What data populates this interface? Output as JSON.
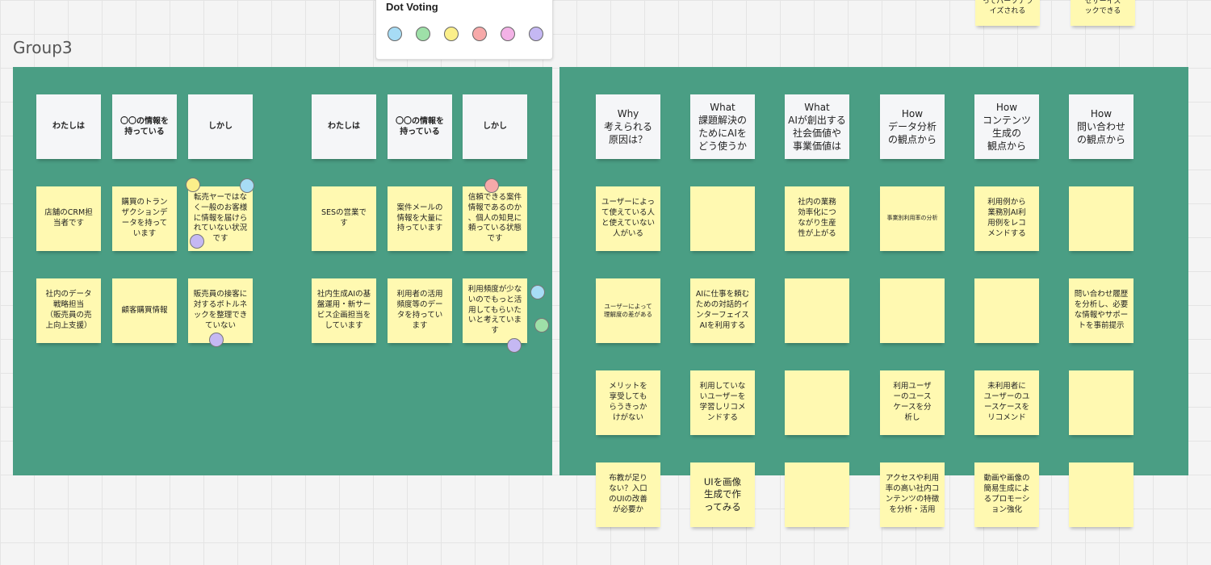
{
  "frame_title": "Group3",
  "voting": {
    "title": "Dot Voting",
    "colors": [
      "#a7dcf5",
      "#9ee0a8",
      "#fbef8a",
      "#f7a9a9",
      "#f3b2e6",
      "#c5b8f3"
    ]
  },
  "top_notes": [
    {
      "text": "ってパーソナラ\nイズされる"
    },
    {
      "text": "セサーイス\nックできる"
    }
  ],
  "left_panel": {
    "group_a": {
      "headers": [
        "わたしは",
        "〇〇の情報を\n持っている",
        "しかし"
      ],
      "row1": [
        "店舗のCRM担\n当者です",
        "購買のトラン\nザクションデ\nータを持って\nいます",
        "転売ヤーではな\nく一般のお客様\nに情報を届けら\nれていない状況\nです"
      ],
      "row2": [
        "社内のデータ\n戦略担当\n（販売員の売\n上向上支援）",
        "顧客購買情報",
        "販売員の接客に\n対するボトルネ\nックを整理でき\nていない"
      ]
    },
    "group_b": {
      "headers": [
        "わたしは",
        "〇〇の情報を\n持っている",
        "しかし"
      ],
      "row1": [
        "SESの営業で\nす",
        "案件メールの\n情報を大量に\n持っています",
        "信頼できる案件\n情報であるのか\n、個人の知見に\n頼っている状態\nです"
      ],
      "row2": [
        "社内生成AIの基\n盤運用・新サー\nビス企画担当を\nしています",
        "利用者の活用\n頻度等のデー\nタを持ってい\nます",
        "利用頻度が少な\nいのでもっと活\n用してもらいた\nいと考えていま\nす"
      ]
    }
  },
  "right_panel": {
    "headers": [
      "Why\n考えられる\n原因は？",
      "What\n課題解決の\nためにAIを\nどう使うか",
      "What\nAIが創出する\n社会価値や\n事業価値は",
      "How\nデータ分析\nの観点から",
      "How\nコンテンツ\n生成の\n観点から",
      "How\n問い合わせ\nの観点から"
    ],
    "rows": [
      [
        "ユーザーによっ\nて使えている人\nと使えていない\n人がいる",
        "",
        "社内の業務\n効率化につ\nながり生産\n性が上がる",
        "事業別利用率の分析",
        "利用例から\n業務別AI利\n用例をレコ\nメンドする",
        ""
      ],
      [
        "ユーザーによって\n理解度の差がある",
        "AIに仕事を頼む\nための対話的イ\nンターフェイス\nAIを利用する",
        "",
        "",
        "",
        "問い合わせ履歴\nを分析し、必要\nな情報やサポー\nトを事前提示"
      ],
      [
        "メリットを\n享受しても\nらうきっか\nけがない",
        "利用していな\nいユーザーを\n学習しリコメ\nンドする",
        "",
        "利用ユーザ\nーのユース\nケースを分\n析し",
        "未利用者に\nユーザーのユ\nースケースを\nリコメンド",
        ""
      ],
      [
        "布教が足り\nない？入口\nのUIの改善\nが必要か",
        "UIを画像\n生成で作\nってみる",
        "",
        "アクセスや利用\n率の高い社内コ\nンテンツの特徴\nを分析・活用",
        "動画や画像の\n簡易生成によ\nるプロモーシ\nョン強化",
        ""
      ]
    ]
  }
}
